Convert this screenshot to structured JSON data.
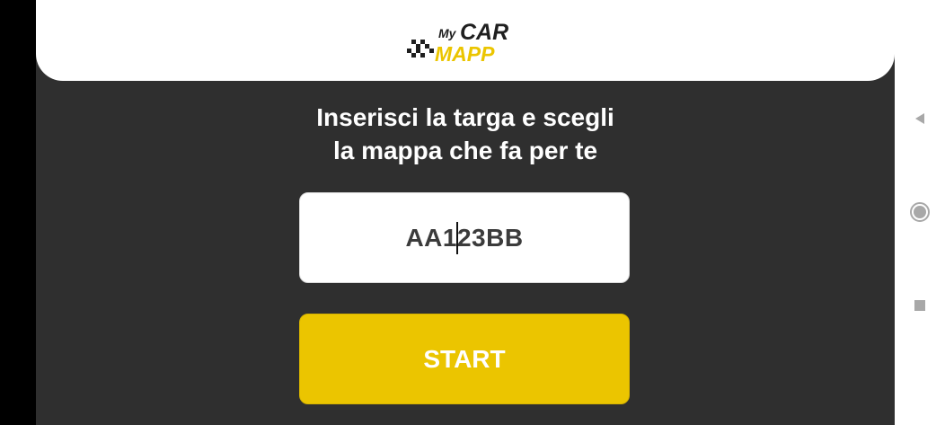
{
  "header": {
    "logo": {
      "line1_small": "My",
      "line1_big": "CAR",
      "line2": "MAPP",
      "primary_color": "#1f1f1f",
      "accent_color": "#ebc500"
    }
  },
  "main": {
    "headline_line1": "Inserisci la targa e scegli",
    "headline_line2": "la mappa che fa per te",
    "plate_input": {
      "value_before_caret": "AA1",
      "value_after_caret": "23BB"
    },
    "start_label": "START",
    "button_color": "#ebc500",
    "background_color": "#2f2f2f"
  },
  "nav_bar": {
    "icons": [
      "back-icon",
      "home-icon",
      "recents-icon"
    ]
  }
}
